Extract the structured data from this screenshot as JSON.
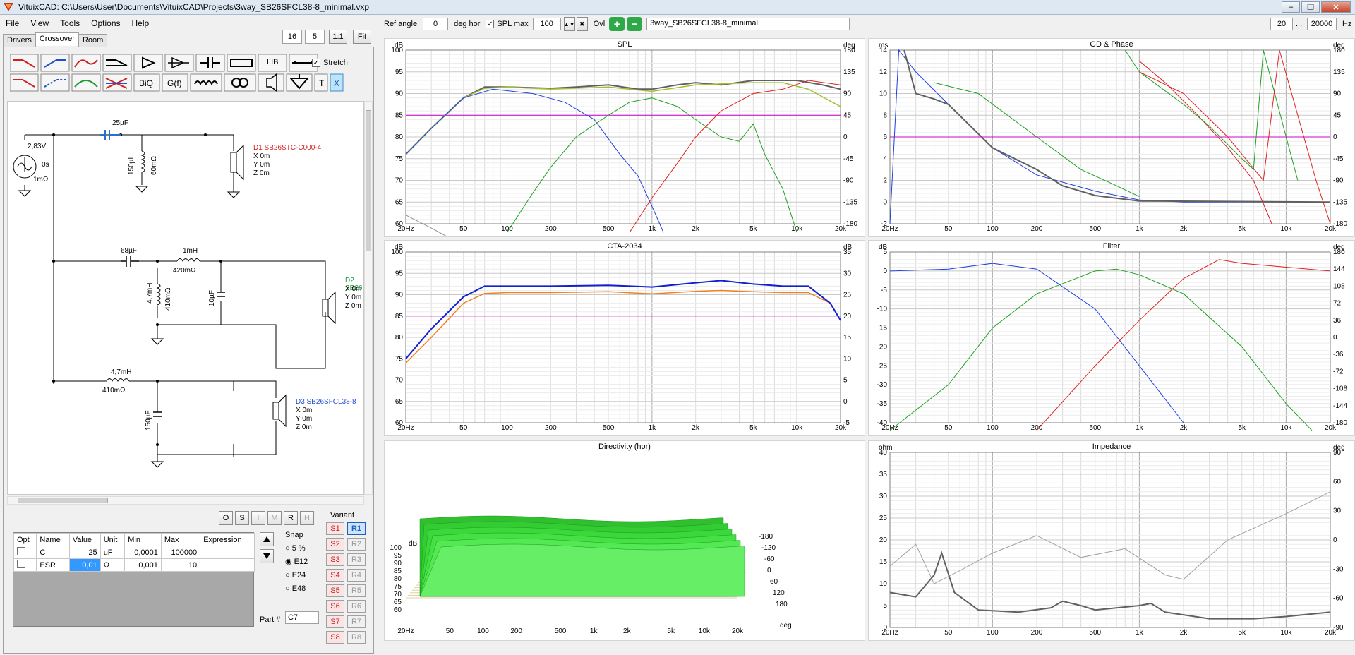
{
  "window": {
    "title": "VituixCAD: C:\\Users\\User\\Documents\\VituixCAD\\Projects\\3way_SB26SFCL38-8_minimal.vxp"
  },
  "menu": [
    "File",
    "View",
    "Tools",
    "Options",
    "Help"
  ],
  "tabs": [
    "Drivers",
    "Crossover",
    "Room"
  ],
  "topfields": {
    "a": "16",
    "b": "5",
    "one": "1:1",
    "fit": "Fit"
  },
  "toolbar": {
    "ref_angle_label": "Ref angle",
    "ref_angle": "0",
    "deg_hor": "deg hor",
    "spl_max_label": "SPL max",
    "spl_max": "100",
    "ovl": "Ovl",
    "project": "3way_SB26SFCL38-8_minimal",
    "f_min": "20",
    "dots": "...",
    "f_max": "20000",
    "hz": "Hz"
  },
  "palette": {
    "lib": "LIB",
    "biq": "BiQ",
    "gf": "G(f)",
    "t": "T",
    "x": "X",
    "stretch": "Stretch"
  },
  "schematic": {
    "c1": "25µF",
    "l1": "150µH",
    "r1": "60mΩ",
    "src_v": "2,83V",
    "src_p": "0s",
    "src_r": "1mΩ",
    "d1": "D1 SB26STC-C000-4",
    "d1x": "X 0m",
    "d1y": "Y 0m",
    "d1z": "Z 0m",
    "c2": "68µF",
    "l2": "1mH",
    "r2": "420mΩ",
    "l3": "4,7mH",
    "r3": "410mΩ",
    "c3": "10µF",
    "d2": "D2 SB26",
    "d2x": "X 0m",
    "d2y": "Y 0m",
    "d2z": "Z 0m",
    "l4": "4,7mH",
    "r4": "410mΩ",
    "c4": "150µF",
    "d3": "D3 SB26SFCL38-8",
    "d3x": "X 0m",
    "d3y": "Y 0m",
    "d3z": "Z 0m"
  },
  "osm": [
    "O",
    "S",
    "I",
    "M",
    "R",
    "H"
  ],
  "table": {
    "headers": [
      "Opt",
      "Name",
      "Value",
      "Unit",
      "Min",
      "Max",
      "Expression"
    ],
    "rows": [
      [
        "",
        "C",
        "25",
        "uF",
        "0,0001",
        "100000",
        ""
      ],
      [
        "",
        "ESR",
        "0,01",
        "Ω",
        "0,001",
        "10",
        ""
      ]
    ]
  },
  "snap": {
    "label": "Snap",
    "options": [
      "5 %",
      "E12",
      "E24",
      "E48"
    ],
    "selected": "E12"
  },
  "part": {
    "label": "Part #",
    "value": "C7"
  },
  "variant": {
    "label": "Variant",
    "s": [
      "S1",
      "S2",
      "S3",
      "S4",
      "S5",
      "S6",
      "S7",
      "S8"
    ],
    "r": [
      "R1",
      "R2",
      "R3",
      "R4",
      "R5",
      "R6",
      "R7",
      "R8"
    ]
  },
  "plots": {
    "spl": {
      "title": "SPL",
      "yl": "dB",
      "yr": "deg",
      "yticks": [
        "100",
        "95",
        "90",
        "85",
        "80",
        "75",
        "70",
        "65",
        "60"
      ],
      "ryticks": [
        "180",
        "135",
        "90",
        "45",
        "0",
        "-45",
        "-90",
        "-135",
        "-180"
      ],
      "xticks": [
        "20Hz",
        "50",
        "100",
        "200",
        "500",
        "1k",
        "2k",
        "5k",
        "10k",
        "20k"
      ]
    },
    "gd": {
      "title": "GD & Phase",
      "yl": "ms",
      "yr": "deg",
      "yticks": [
        "14",
        "12",
        "10",
        "8",
        "6",
        "4",
        "2",
        "0",
        "-2"
      ],
      "ryticks": [
        "180",
        "135",
        "90",
        "45",
        "0",
        "-45",
        "-90",
        "-135",
        "-180"
      ],
      "xticks": [
        "20Hz",
        "50",
        "100",
        "200",
        "500",
        "1k",
        "2k",
        "5k",
        "10k",
        "20k"
      ]
    },
    "cta": {
      "title": "CTA-2034",
      "yl": "dB",
      "yr": "dB",
      "yticks": [
        "100",
        "95",
        "90",
        "85",
        "80",
        "75",
        "70",
        "65",
        "60"
      ],
      "ryticks": [
        "35",
        "30",
        "25",
        "20",
        "15",
        "10",
        "5",
        "0",
        "-5"
      ],
      "xticks": [
        "20Hz",
        "50",
        "100",
        "200",
        "500",
        "1k",
        "2k",
        "5k",
        "10k",
        "20k"
      ]
    },
    "filter": {
      "title": "Filter",
      "yl": "dB",
      "yr": "deg",
      "yticks": [
        "5",
        "0",
        "-5",
        "-10",
        "-15",
        "-20",
        "-25",
        "-30",
        "-35",
        "-40"
      ],
      "ryticks": [
        "180",
        "144",
        "108",
        "72",
        "36",
        "0",
        "-36",
        "-72",
        "-108",
        "-144",
        "-180"
      ],
      "xticks": [
        "20Hz",
        "50",
        "100",
        "200",
        "500",
        "1k",
        "2k",
        "5k",
        "10k",
        "20k"
      ]
    },
    "dir": {
      "title": "Directivity (hor)",
      "yl": "dB",
      "yticks": [
        "100",
        "95",
        "90",
        "85",
        "80",
        "75",
        "70",
        "65",
        "60"
      ],
      "angles": [
        "-180",
        "-120",
        "-60",
        "0",
        "60",
        "120",
        "180"
      ],
      "deg": "deg",
      "xticks": [
        "20Hz",
        "50",
        "100",
        "200",
        "500",
        "1k",
        "2k",
        "5k",
        "10k",
        "20k"
      ]
    },
    "imp": {
      "title": "Impedance",
      "yl": "ohm",
      "yr": "deg",
      "yticks": [
        "40",
        "35",
        "30",
        "25",
        "20",
        "15",
        "10",
        "5",
        "0"
      ],
      "ryticks": [
        "90",
        "60",
        "30",
        "0",
        "-30",
        "-60",
        "-90"
      ],
      "xticks": [
        "20Hz",
        "50",
        "100",
        "200",
        "500",
        "1k",
        "2k",
        "5k",
        "10k",
        "20k"
      ]
    }
  }
}
